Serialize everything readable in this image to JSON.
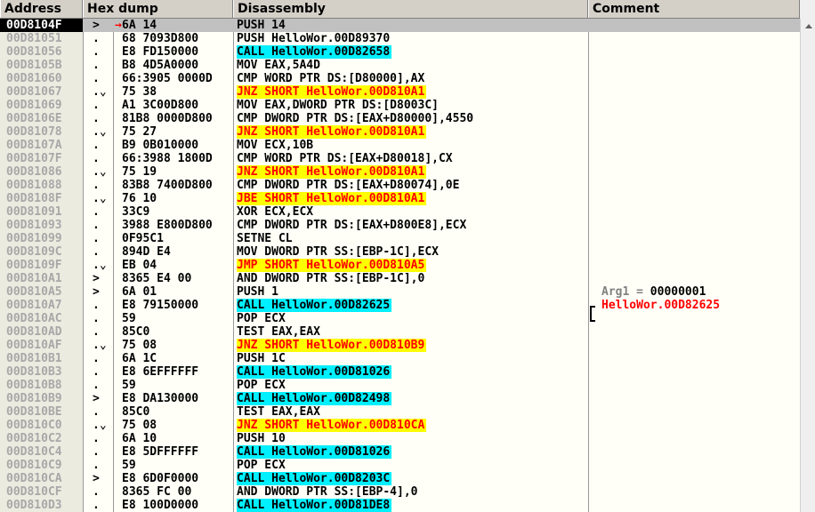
{
  "columns": {
    "address": "Address",
    "hex": "Hex dump",
    "disassembly": "Disassembly",
    "comment": "Comment"
  },
  "colors": {
    "jump_highlight": "#ffff00",
    "jump_text": "#ff0000",
    "call_highlight": "#00f0ff",
    "selected_row": "#c0c0c0"
  },
  "rows": [
    {
      "addr": "00D8104F",
      "jump": ">",
      "bytes": "6A 14",
      "dis": "PUSH 14",
      "kind": "norm",
      "selected": true,
      "arrow": "→"
    },
    {
      "addr": "00D81051",
      "jump": ".",
      "bytes": "68 7093D800",
      "dis": "PUSH HelloWor.00D89370",
      "kind": "norm"
    },
    {
      "addr": "00D81056",
      "jump": ".",
      "bytes": "E8 FD150000",
      "dis": "CALL HelloWor.00D82658",
      "kind": "call"
    },
    {
      "addr": "00D8105B",
      "jump": ".",
      "bytes": "B8 4D5A0000",
      "dis": "MOV EAX,5A4D",
      "kind": "norm"
    },
    {
      "addr": "00D81060",
      "jump": ".",
      "bytes": "66:3905 0000D",
      "dis": "CMP WORD PTR DS:[D80000],AX",
      "kind": "norm"
    },
    {
      "addr": "00D81067",
      "jump": ".⌄",
      "bytes": "75 38",
      "dis": "JNZ SHORT HelloWor.00D810A1",
      "kind": "jmp"
    },
    {
      "addr": "00D81069",
      "jump": ".",
      "bytes": "A1 3C00D800",
      "dis": "MOV EAX,DWORD PTR DS:[D8003C]",
      "kind": "norm"
    },
    {
      "addr": "00D8106E",
      "jump": ".",
      "bytes": "81B8 0000D800",
      "dis": "CMP DWORD PTR DS:[EAX+D80000],4550",
      "kind": "norm"
    },
    {
      "addr": "00D81078",
      "jump": ".⌄",
      "bytes": "75 27",
      "dis": "JNZ SHORT HelloWor.00D810A1",
      "kind": "jmp"
    },
    {
      "addr": "00D8107A",
      "jump": ".",
      "bytes": "B9 0B010000",
      "dis": "MOV ECX,10B",
      "kind": "norm"
    },
    {
      "addr": "00D8107F",
      "jump": ".",
      "bytes": "66:3988 1800D",
      "dis": "CMP WORD PTR DS:[EAX+D80018],CX",
      "kind": "norm"
    },
    {
      "addr": "00D81086",
      "jump": ".⌄",
      "bytes": "75 19",
      "dis": "JNZ SHORT HelloWor.00D810A1",
      "kind": "jmp"
    },
    {
      "addr": "00D81088",
      "jump": ".",
      "bytes": "83B8 7400D800",
      "dis": "CMP DWORD PTR DS:[EAX+D80074],0E",
      "kind": "norm"
    },
    {
      "addr": "00D8108F",
      "jump": ".⌄",
      "bytes": "76 10",
      "dis": "JBE SHORT HelloWor.00D810A1",
      "kind": "jmp"
    },
    {
      "addr": "00D81091",
      "jump": ".",
      "bytes": "33C9",
      "dis": "XOR ECX,ECX",
      "kind": "norm"
    },
    {
      "addr": "00D81093",
      "jump": ".",
      "bytes": "3988 E800D800",
      "dis": "CMP DWORD PTR DS:[EAX+D800E8],ECX",
      "kind": "norm"
    },
    {
      "addr": "00D81099",
      "jump": ".",
      "bytes": "0F95C1",
      "dis": "SETNE CL",
      "kind": "norm"
    },
    {
      "addr": "00D8109C",
      "jump": ".",
      "bytes": "894D E4",
      "dis": "MOV DWORD PTR SS:[EBP-1C],ECX",
      "kind": "norm"
    },
    {
      "addr": "00D8109F",
      "jump": ".⌄",
      "bytes": "EB 04",
      "dis": "JMP SHORT HelloWor.00D810A5",
      "kind": "jmp"
    },
    {
      "addr": "00D810A1",
      "jump": ">",
      "bytes": "8365 E4 00",
      "dis": "AND DWORD PTR SS:[EBP-1C],0",
      "kind": "norm"
    },
    {
      "addr": "00D810A5",
      "jump": ">",
      "bytes": "6A 01",
      "dis": "PUSH 1",
      "kind": "norm",
      "comment": "Arg1 = 00000001",
      "comment_kind": "arg"
    },
    {
      "addr": "00D810A7",
      "jump": ".",
      "bytes": "E8 79150000",
      "dis": "CALL HelloWor.00D82625",
      "kind": "call",
      "comment": "HelloWor.00D82625",
      "comment_kind": "ptr"
    },
    {
      "addr": "00D810AC",
      "jump": ".",
      "bytes": "59",
      "dis": "POP ECX",
      "kind": "norm"
    },
    {
      "addr": "00D810AD",
      "jump": ".",
      "bytes": "85C0",
      "dis": "TEST EAX,EAX",
      "kind": "norm"
    },
    {
      "addr": "00D810AF",
      "jump": ".⌄",
      "bytes": "75 08",
      "dis": "JNZ SHORT HelloWor.00D810B9",
      "kind": "jmp"
    },
    {
      "addr": "00D810B1",
      "jump": ".",
      "bytes": "6A 1C",
      "dis": "PUSH 1C",
      "kind": "norm"
    },
    {
      "addr": "00D810B3",
      "jump": ".",
      "bytes": "E8 6EFFFFFF",
      "dis": "CALL HelloWor.00D81026",
      "kind": "call"
    },
    {
      "addr": "00D810B8",
      "jump": ".",
      "bytes": "59",
      "dis": "POP ECX",
      "kind": "norm"
    },
    {
      "addr": "00D810B9",
      "jump": ">",
      "bytes": "E8 DA130000",
      "dis": "CALL HelloWor.00D82498",
      "kind": "call"
    },
    {
      "addr": "00D810BE",
      "jump": ".",
      "bytes": "85C0",
      "dis": "TEST EAX,EAX",
      "kind": "norm"
    },
    {
      "addr": "00D810C0",
      "jump": ".⌄",
      "bytes": "75 08",
      "dis": "JNZ SHORT HelloWor.00D810CA",
      "kind": "jmp"
    },
    {
      "addr": "00D810C2",
      "jump": ".",
      "bytes": "6A 10",
      "dis": "PUSH 10",
      "kind": "norm"
    },
    {
      "addr": "00D810C4",
      "jump": ".",
      "bytes": "E8 5DFFFFFF",
      "dis": "CALL HelloWor.00D81026",
      "kind": "call"
    },
    {
      "addr": "00D810C9",
      "jump": ".",
      "bytes": "59",
      "dis": "POP ECX",
      "kind": "norm"
    },
    {
      "addr": "00D810CA",
      "jump": ">",
      "bytes": "E8 6D0F0000",
      "dis": "CALL HelloWor.00D8203C",
      "kind": "call"
    },
    {
      "addr": "00D810CF",
      "jump": ".",
      "bytes": "8365 FC 00",
      "dis": "AND DWORD PTR SS:[EBP-4],0",
      "kind": "norm"
    },
    {
      "addr": "00D810D3",
      "jump": ".",
      "bytes": "E8 100D0000",
      "dis": "CALL HelloWor.00D81DE8",
      "kind": "call"
    }
  ]
}
